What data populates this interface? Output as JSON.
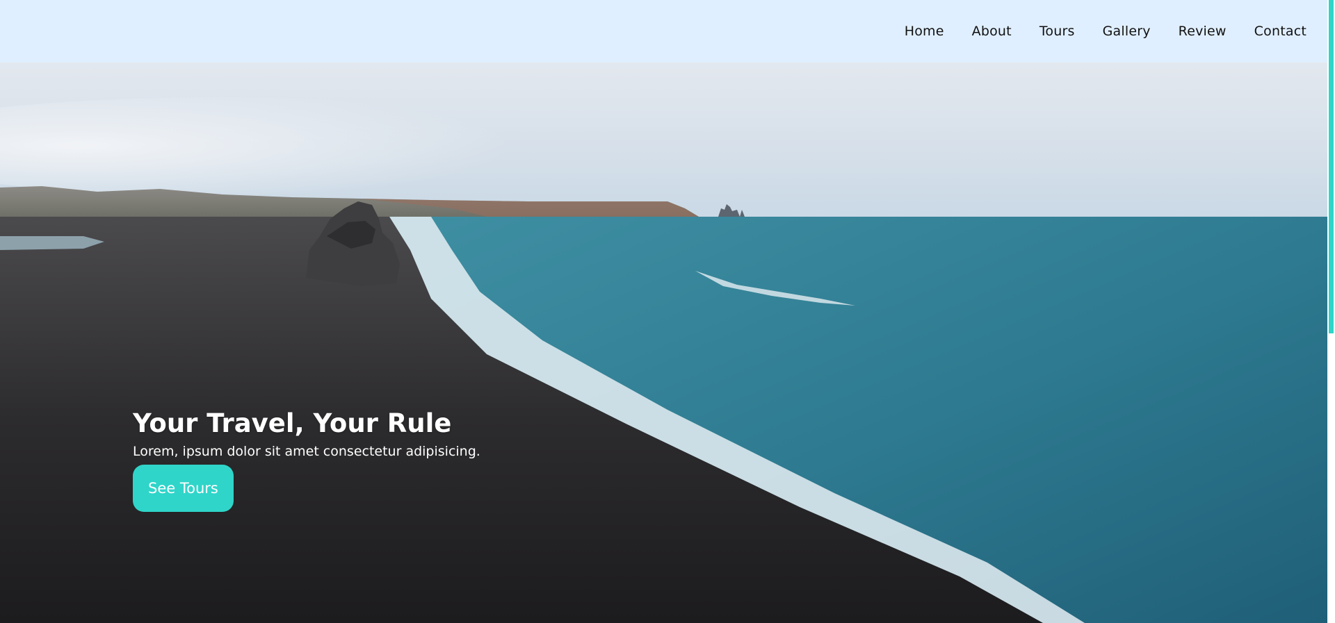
{
  "nav": {
    "links": [
      {
        "label": "Home"
      },
      {
        "label": "About"
      },
      {
        "label": "Tours"
      },
      {
        "label": "Gallery"
      },
      {
        "label": "Review"
      },
      {
        "label": "Contact"
      }
    ]
  },
  "hero": {
    "title": "Your Travel, Your Rule",
    "subtitle": "Lorem, ipsum dolor sit amet consectetur adipisicing.",
    "cta_label": "See Tours"
  },
  "colors": {
    "navbar_bg": "#e0efff",
    "accent": "#2fd5c9",
    "hero_text": "#ffffff",
    "nav_text": "#111111"
  }
}
